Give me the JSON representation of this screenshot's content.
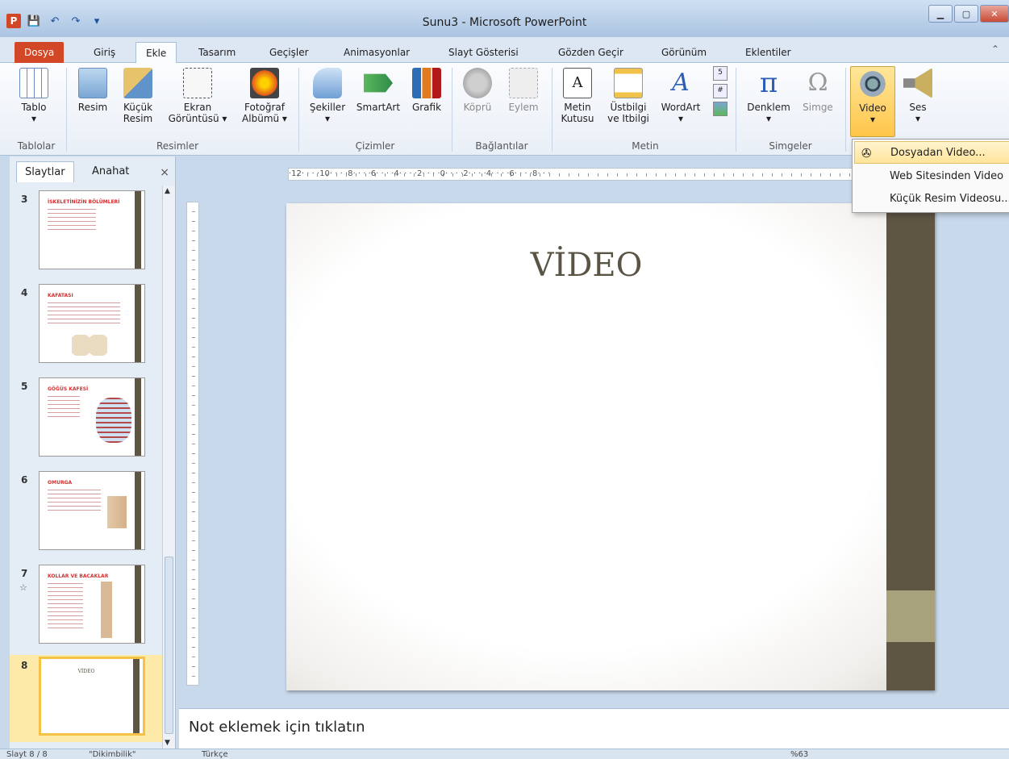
{
  "window": {
    "title": "Sunu3 - Microsoft PowerPoint"
  },
  "qat": {
    "logo": "P",
    "save": "💾",
    "undo": "↶",
    "redo": "↷",
    "more": "▾"
  },
  "tabs": [
    "Dosya",
    "Giriş",
    "Ekle",
    "Tasarım",
    "Geçişler",
    "Animasyonlar",
    "Slayt Gösterisi",
    "Gözden Geçir",
    "Görünüm",
    "Eklentiler"
  ],
  "ribbon": {
    "tablo": "Tablo",
    "resim": "Resim",
    "kucuk_resim_1": "Küçük",
    "kucuk_resim_2": "Resim",
    "ekran_1": "Ekran",
    "ekran_2": "Görüntüsü ▾",
    "foto_1": "Fotoğraf",
    "foto_2": "Albümü ▾",
    "sekiller": "Şekiller",
    "smartart": "SmartArt",
    "grafik": "Grafik",
    "kopru": "Köprü",
    "eylem": "Eylem",
    "metin_1": "Metin",
    "metin_2": "Kutusu",
    "ustbilgi_1": "Üstbilgi",
    "ustbilgi_2": "ve Itbilgi",
    "wordart": "WordArt",
    "denklem": "Denklem",
    "simge": "Simge",
    "video": "Video",
    "ses": "Ses",
    "groups": {
      "tablolar": "Tablolar",
      "resimler": "Resimler",
      "cizimler": "Çizimler",
      "baglantilar": "Bağlantılar",
      "metin": "Metin",
      "simgeler": "Simgeler"
    }
  },
  "video_menu": {
    "from_file": "Dosyadan Video...",
    "from_web": "Web Sitesinden Video",
    "clipart": "Küçük Resim Videosu..."
  },
  "panel": {
    "tab_slides": "Slaytlar",
    "tab_outline": "Anahat",
    "close": "×",
    "slides": [
      {
        "num": "3",
        "title": "İSKELETİNİZİN BÖLÜMLERİ"
      },
      {
        "num": "4",
        "title": "KAFATASI"
      },
      {
        "num": "5",
        "title": "GÖĞÜS KAFESİ"
      },
      {
        "num": "6",
        "title": "OMURGA"
      },
      {
        "num": "7",
        "title": "KOLLAR VE BACAKLAR"
      },
      {
        "num": "8",
        "title": "VİDEO"
      }
    ]
  },
  "ruler": {
    "marks": "·12·  ·  ·  ·10·  ·  ·  ·8·  ·  ·  ·6·  ·  ·  ·4·  ·  ·  ·2·  ·  ·  ·0·  ·  ·  ·2·  ·  ·  ·4·  ·  ·  ·6·  ·  ·  ·8·  ·  ·"
  },
  "slide": {
    "title": "VİDEO"
  },
  "notes": {
    "placeholder": "Not eklemek için tıklatın"
  },
  "status": {
    "slide_info": "Slayt 8 / 8",
    "theme": "\"Dikimbilik\"",
    "language": "Türkçe",
    "zoom": "%63"
  },
  "colors": {
    "file_tab": "#d24726",
    "slide_stripe": "#5e5543",
    "slide_accent": "#a8a27c",
    "highlight": "#ffc64a"
  }
}
